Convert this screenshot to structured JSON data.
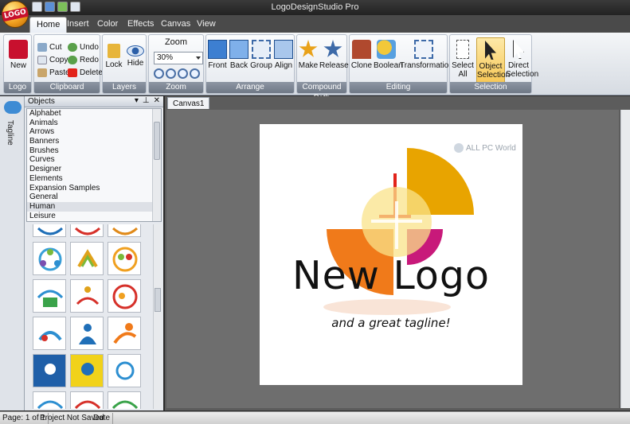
{
  "app": {
    "title": "LogoDesignStudio Pro",
    "orb_label": "LOGO"
  },
  "tabs": [
    "Home",
    "Insert",
    "Color",
    "Effects",
    "Canvas",
    "View"
  ],
  "ribbon": {
    "logo_group": {
      "new_label": "New",
      "group_label": "Logo"
    },
    "clipboard": {
      "cut": "Cut",
      "copy": "Copy",
      "paste": "Paste",
      "undo": "Undo",
      "redo": "Redo",
      "delete": "Delete",
      "group_label": "Clipboard"
    },
    "layers": {
      "lock": "Lock",
      "hide": "Hide",
      "group_label": "Layers"
    },
    "zoom": {
      "title": "Zoom",
      "value": "30%",
      "group_label": "Zoom"
    },
    "arrange": {
      "front": "Front",
      "back": "Back",
      "group": "Group",
      "align": "Align",
      "group_label": "Arrange"
    },
    "compound_path": {
      "make": "Make",
      "release": "Release",
      "group_label": "Compound Path"
    },
    "editing": {
      "clone": "Clone",
      "boolean": "Boolean",
      "transformation": "Transformation",
      "group_label": "Editing"
    },
    "selection": {
      "select_all": "Select All",
      "object_selection": "Object Selection",
      "direct_selection": "Direct Selection",
      "group_label": "Selection"
    }
  },
  "side_tab": {
    "label": "Tagline"
  },
  "objects_panel": {
    "title": "Objects",
    "items": [
      "Alphabet",
      "Animals",
      "Arrows",
      "Banners",
      "Brushes",
      "Curves",
      "Designer",
      "Elements",
      "Expansion Samples",
      "General",
      "Human",
      "Leisure"
    ],
    "selected": "Human"
  },
  "canvas": {
    "tab_label": "Canvas1",
    "watermark": "ALL PC World",
    "logo_title": "New Logo",
    "logo_tagline": "and a great tagline!"
  },
  "statusbar": {
    "page": "Page: 1 of 1",
    "project": "Project Not Saved",
    "date": "Date"
  },
  "colors": {
    "accent_orange": "#f07a1a",
    "accent_gold": "#e8a400",
    "accent_magenta": "#c8197a",
    "accent_red": "#e2231a"
  }
}
